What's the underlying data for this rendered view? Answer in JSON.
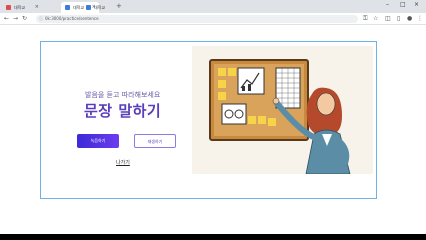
{
  "browser": {
    "tabs": [
      {
        "title": "대학교",
        "active": false,
        "favicon_color": "#e04b4b"
      },
      {
        "title": "대학교",
        "active": true,
        "favicon_color": "#3f7bd9"
      },
      {
        "title": "대학교",
        "active": false,
        "favicon_color": "#3f7bd9"
      }
    ],
    "new_tab_icon": "plus-icon",
    "url": "0k:3000/practice/sentence",
    "colors": {
      "tabbar": "#dfe3e8",
      "url_bg": "#eef1f4"
    }
  },
  "page": {
    "subtitle": "발음을 듣고 따라해보세요",
    "title": "문장 말하기",
    "primary_button": "녹음하기",
    "secondary_button": "재생하기",
    "back_link": "나가기",
    "colors": {
      "accent": "#5a3fbd",
      "card_border": "#6fb3e6",
      "button_gradient_start": "#3d2ad6",
      "button_gradient_end": "#6c3cf0"
    },
    "illustration": "woman-presenting-at-corkboard"
  }
}
